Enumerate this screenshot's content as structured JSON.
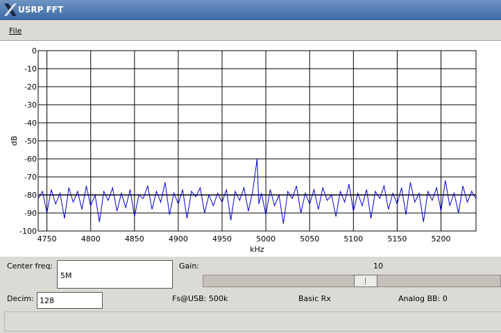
{
  "window": {
    "title": "USRP FFT"
  },
  "menu": {
    "file_label": "File"
  },
  "chart_data": {
    "type": "line",
    "xlabel": "kHz",
    "ylabel": "dB",
    "xlim": [
      4740,
      5240
    ],
    "ylim": [
      -100,
      0
    ],
    "x_ticks": [
      4750,
      4800,
      4850,
      4900,
      4950,
      5000,
      5050,
      5100,
      5150,
      5200
    ],
    "y_ticks": [
      0,
      -10,
      -20,
      -30,
      -40,
      -50,
      -60,
      -70,
      -80,
      -90,
      -100
    ],
    "grid": true,
    "noise_floor_db": -80,
    "peak": {
      "x": 4990,
      "y": -60
    },
    "series_color": "#0000cc",
    "series": [
      {
        "values": [
          [
            4740,
            -82
          ],
          [
            4745,
            -78
          ],
          [
            4750,
            -90
          ],
          [
            4755,
            -77
          ],
          [
            4760,
            -85
          ],
          [
            4765,
            -79
          ],
          [
            4770,
            -93
          ],
          [
            4775,
            -76
          ],
          [
            4780,
            -84
          ],
          [
            4785,
            -78
          ],
          [
            4790,
            -88
          ],
          [
            4795,
            -75
          ],
          [
            4800,
            -86
          ],
          [
            4805,
            -80
          ],
          [
            4810,
            -95
          ],
          [
            4815,
            -78
          ],
          [
            4820,
            -83
          ],
          [
            4825,
            -76
          ],
          [
            4830,
            -89
          ],
          [
            4835,
            -79
          ],
          [
            4840,
            -87
          ],
          [
            4845,
            -77
          ],
          [
            4850,
            -92
          ],
          [
            4855,
            -80
          ],
          [
            4860,
            -82
          ],
          [
            4865,
            -75
          ],
          [
            4870,
            -88
          ],
          [
            4875,
            -78
          ],
          [
            4880,
            -84
          ],
          [
            4885,
            -73
          ],
          [
            4890,
            -91
          ],
          [
            4895,
            -79
          ],
          [
            4900,
            -85
          ],
          [
            4905,
            -77
          ],
          [
            4910,
            -93
          ],
          [
            4915,
            -78
          ],
          [
            4920,
            -81
          ],
          [
            4925,
            -76
          ],
          [
            4930,
            -90
          ],
          [
            4935,
            -80
          ],
          [
            4940,
            -86
          ],
          [
            4945,
            -79
          ],
          [
            4950,
            -84
          ],
          [
            4955,
            -77
          ],
          [
            4960,
            -94
          ],
          [
            4965,
            -78
          ],
          [
            4970,
            -83
          ],
          [
            4975,
            -76
          ],
          [
            4980,
            -89
          ],
          [
            4985,
            -78
          ],
          [
            4990,
            -60
          ],
          [
            4992,
            -85
          ],
          [
            4995,
            -79
          ],
          [
            5000,
            -91
          ],
          [
            5005,
            -77
          ],
          [
            5010,
            -86
          ],
          [
            5015,
            -80
          ],
          [
            5020,
            -96
          ],
          [
            5025,
            -78
          ],
          [
            5030,
            -82
          ],
          [
            5035,
            -75
          ],
          [
            5040,
            -90
          ],
          [
            5045,
            -79
          ],
          [
            5050,
            -85
          ],
          [
            5055,
            -77
          ],
          [
            5060,
            -88
          ],
          [
            5065,
            -76
          ],
          [
            5070,
            -83
          ],
          [
            5075,
            -80
          ],
          [
            5080,
            -92
          ],
          [
            5085,
            -78
          ],
          [
            5090,
            -84
          ],
          [
            5095,
            -74
          ],
          [
            5100,
            -89
          ],
          [
            5105,
            -79
          ],
          [
            5110,
            -86
          ],
          [
            5115,
            -77
          ],
          [
            5120,
            -93
          ],
          [
            5125,
            -78
          ],
          [
            5130,
            -82
          ],
          [
            5135,
            -75
          ],
          [
            5140,
            -88
          ],
          [
            5145,
            -79
          ],
          [
            5150,
            -85
          ],
          [
            5155,
            -76
          ],
          [
            5160,
            -91
          ],
          [
            5165,
            -73
          ],
          [
            5170,
            -84
          ],
          [
            5175,
            -79
          ],
          [
            5180,
            -95
          ],
          [
            5185,
            -78
          ],
          [
            5190,
            -83
          ],
          [
            5195,
            -76
          ],
          [
            5200,
            -89
          ],
          [
            5205,
            -72
          ],
          [
            5210,
            -86
          ],
          [
            5215,
            -79
          ],
          [
            5220,
            -90
          ],
          [
            5225,
            -75
          ],
          [
            5230,
            -84
          ],
          [
            5235,
            -78
          ],
          [
            5240,
            -82
          ]
        ]
      }
    ]
  },
  "controls": {
    "center_freq_label": "Center freq:",
    "center_freq_value": "5M",
    "gain_label": "Gain:",
    "gain_value": "10",
    "gain_slider_fraction": 0.55,
    "decim_label": "Decim:",
    "decim_value": "128",
    "fs_usb_label": "Fs@USB: 500k",
    "basic_rx_label": "Basic Rx",
    "analog_bb_label": "Analog BB: 0"
  }
}
